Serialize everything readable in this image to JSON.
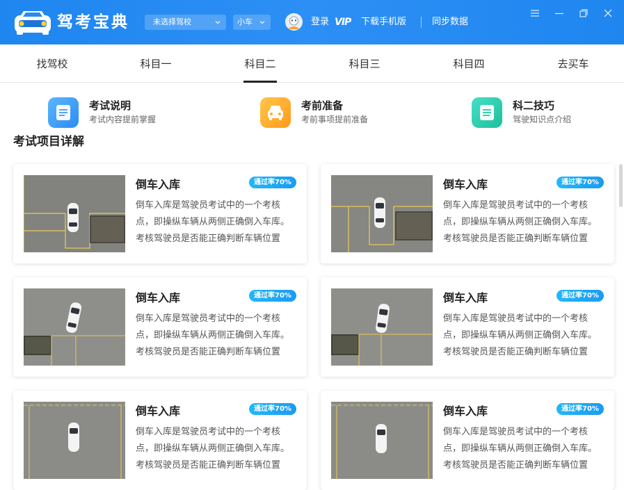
{
  "header": {
    "app_name": "驾考宝典",
    "school_select": "未选择驾校",
    "car_select": "小车",
    "login": "登录",
    "vip": "VIP",
    "download": "下载手机版",
    "sync": "同步数据"
  },
  "tabs": [
    "找驾校",
    "科目一",
    "科目二",
    "科目三",
    "科目四",
    "去买车"
  ],
  "active_tab": "科目二",
  "quick_links": [
    {
      "title": "考试说明",
      "subtitle": "考试内容提前掌握",
      "icon": "document-icon"
    },
    {
      "title": "考前准备",
      "subtitle": "考前事项提前准备",
      "icon": "car-front-icon"
    },
    {
      "title": "科二技巧",
      "subtitle": "驾驶知识点介绍",
      "icon": "notes-icon"
    }
  ],
  "section_title": "考试项目详解",
  "cards": [
    {
      "title": "倒车入库",
      "badge": "通过率70%",
      "desc": "倒车入库是驾驶员考试中的一个考核点，即操纵车辆从两侧正确倒入车库。考核驾驶员是否能正确判断车辆位置"
    },
    {
      "title": "倒车入库",
      "badge": "通过率70%",
      "desc": "倒车入库是驾驶员考试中的一个考核点，即操纵车辆从两侧正确倒入车库。考核驾驶员是否能正确判断车辆位置"
    },
    {
      "title": "倒车入库",
      "badge": "通过率70%",
      "desc": "倒车入库是驾驶员考试中的一个考核点，即操纵车辆从两侧正确倒入车库。考核驾驶员是否能正确判断车辆位置"
    },
    {
      "title": "倒车入库",
      "badge": "通过率70%",
      "desc": "倒车入库是驾驶员考试中的一个考核点，即操纵车辆从两侧正确倒入车库。考核驾驶员是否能正确判断车辆位置"
    },
    {
      "title": "倒车入库",
      "badge": "通过率70%",
      "desc": "倒车入库是驾驶员考试中的一个考核点，即操纵车辆从两侧正确倒入车库。考核驾驶员是否能正确判断车辆位置"
    },
    {
      "title": "倒车入库",
      "badge": "通过率70%",
      "desc": "倒车入库是驾驶员考试中的一个考核点，即操纵车辆从两侧正确倒入车库。考核驾驶员是否能正确判断车辆位置"
    }
  ],
  "colors": {
    "header_blue": "#2389f2",
    "badge_blue": "#1fa9f5"
  }
}
